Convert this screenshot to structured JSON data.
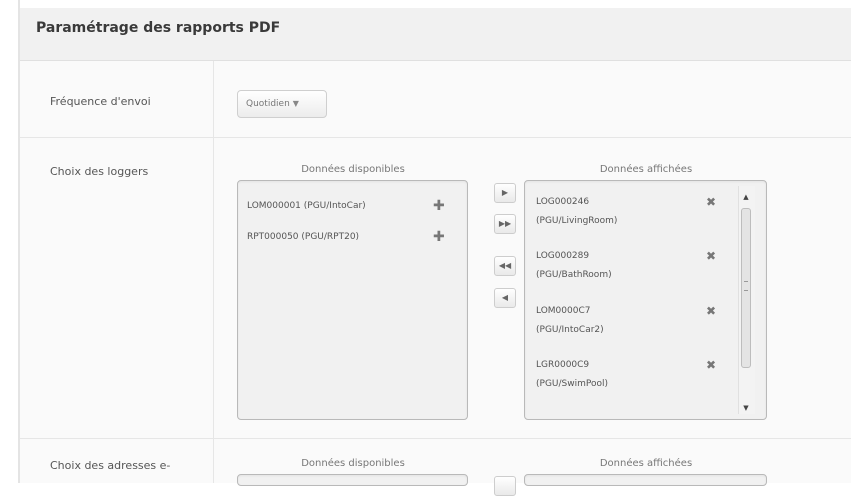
{
  "panel": {
    "title": "Paramétrage des rapports PDF"
  },
  "frequency": {
    "label": "Fréquence d'envoi",
    "value": "Quotidien"
  },
  "loggers": {
    "label": "Choix des loggers",
    "available": {
      "header": "Données disponibles",
      "items": [
        {
          "label": "LOM000001 (PGU/IntoCar)"
        },
        {
          "label": "RPT000050 (PGU/RPT20)"
        }
      ]
    },
    "displayed": {
      "header": "Données affichées",
      "items": [
        {
          "line1": "LOG000246",
          "line2": "(PGU/LivingRoom)"
        },
        {
          "line1": "LOG000289",
          "line2": "(PGU/BathRoom)"
        },
        {
          "line1": "LOM0000C7",
          "line2": "(PGU/IntoCar2)"
        },
        {
          "line1": "LGR0000C9",
          "line2": "(PGU/SwimPool)"
        }
      ]
    }
  },
  "emails": {
    "label": "Choix des adresses e-",
    "available_header": "Données disponibles",
    "displayed_header": "Données affichées"
  },
  "icons": {
    "add": "plus-icon",
    "remove": "remove-icon",
    "move_right": "arrow-right-icon",
    "move_all_right": "double-arrow-right-icon",
    "move_all_left": "double-arrow-left-icon",
    "move_left": "arrow-left-icon"
  }
}
